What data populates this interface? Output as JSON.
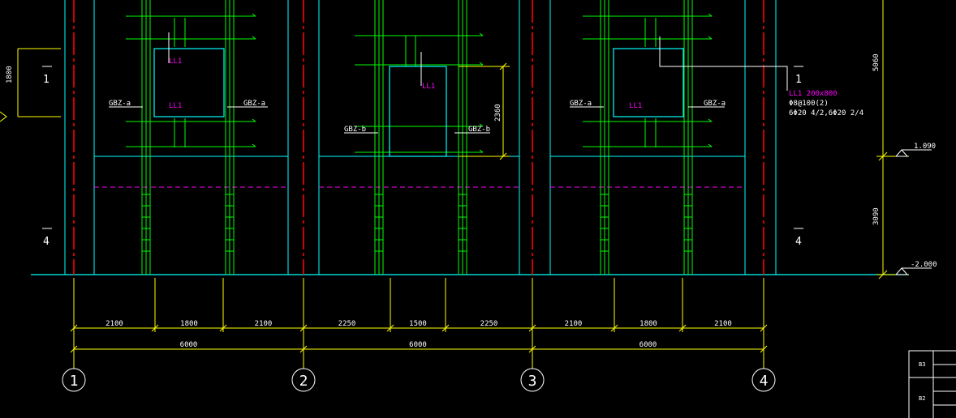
{
  "colors": {
    "background": "#000000",
    "wall_outline": "#00ffff",
    "rebar": "#00ff00",
    "axis_line": "#ff0000",
    "dimension": "#ffff00",
    "section_dash": "#ff00ff",
    "beam_label": "#ff00ff",
    "text": "#ffffff"
  },
  "column_labels": {
    "gbz_a": "GBZ-a",
    "gbz_b": "GBZ-b"
  },
  "beam_label": "LL1",
  "beam_spec": {
    "title": "LL1 200x800",
    "stirrup": "Φ8@100(2)",
    "bars": "6Φ20 4/2,6Φ20 2/4"
  },
  "opening_height": "2360",
  "floor_marks": {
    "top_left": "1",
    "bottom_left": "4",
    "top_right": "1",
    "bottom_right": "4",
    "left_height": "1800"
  },
  "elevations": {
    "upper": "1.090",
    "lower": "-2.000",
    "upper_height": "5060",
    "lower_height": "3090"
  },
  "dimensions": {
    "segments": [
      "2100",
      "1800",
      "2100",
      "2250",
      "1500",
      "2250",
      "2100",
      "1800",
      "2100"
    ],
    "bays": [
      "6000",
      "6000",
      "6000"
    ]
  },
  "axes": [
    "1",
    "2",
    "3",
    "4"
  ],
  "title_block": {
    "row1": "B3",
    "row2": "B2"
  }
}
